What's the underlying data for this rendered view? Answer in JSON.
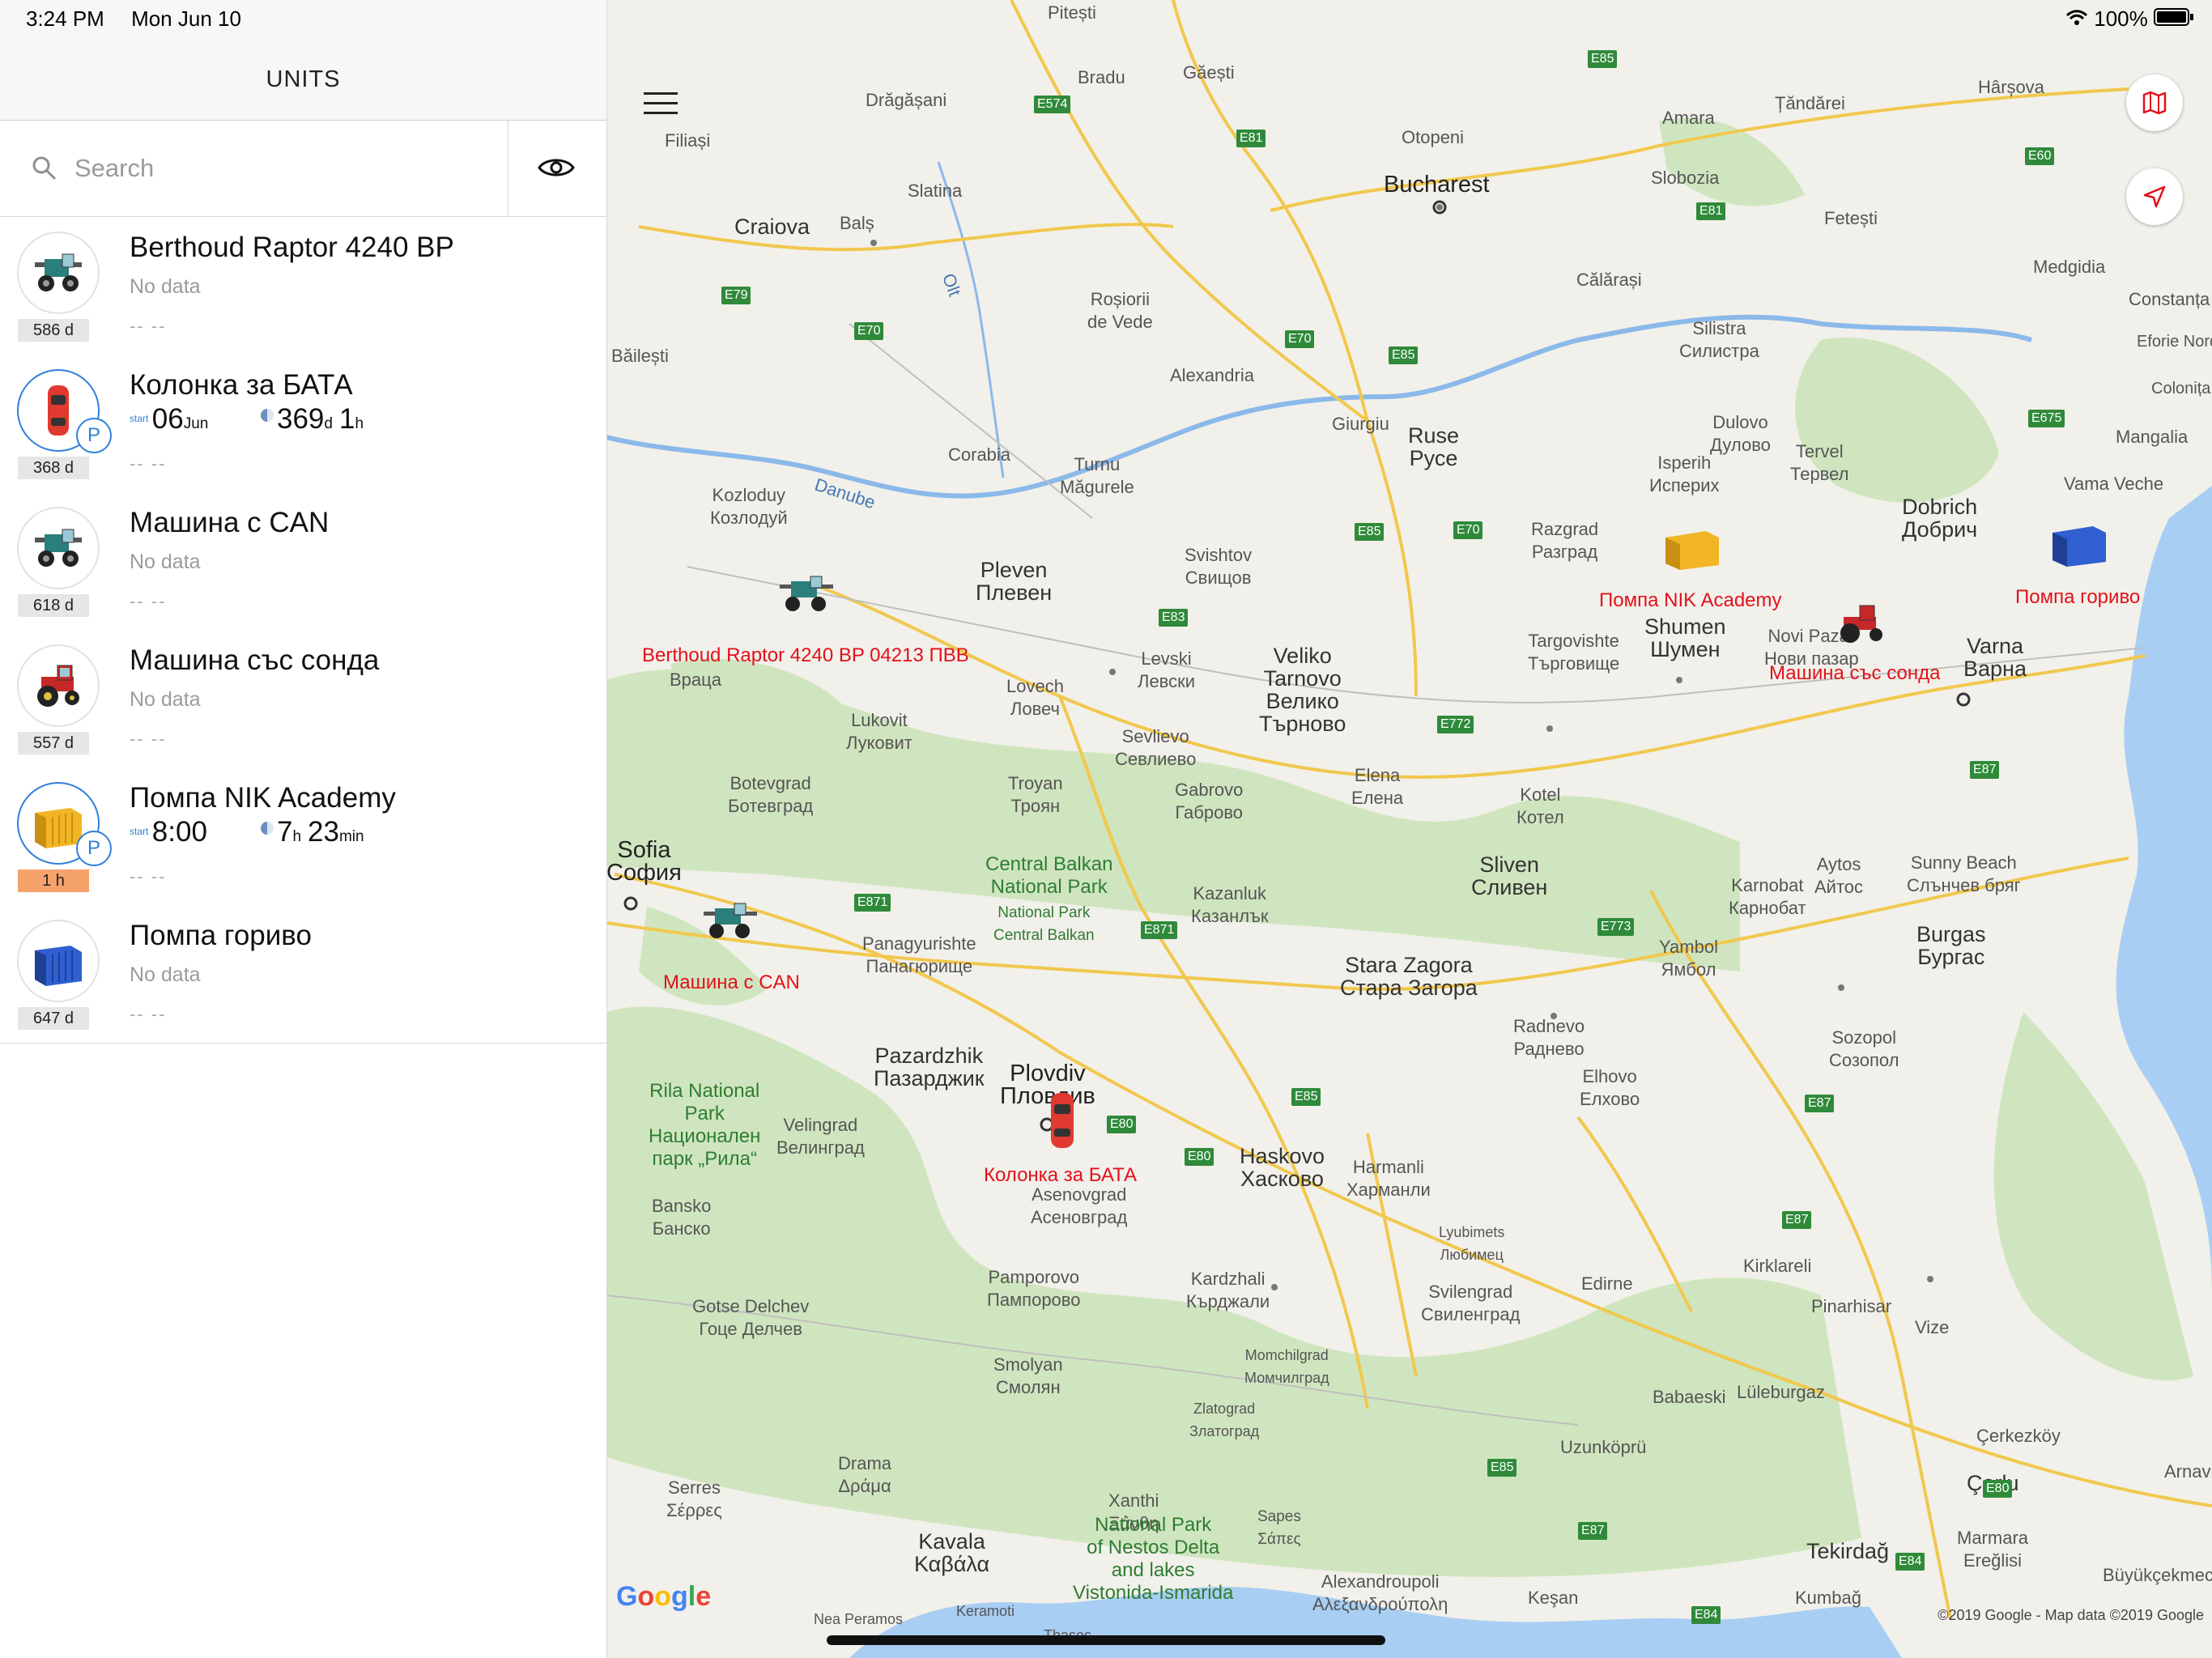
{
  "status_bar": {
    "time": "3:24 PM",
    "date": "Mon Jun 10",
    "battery": "100%"
  },
  "panel": {
    "title": "UNITS",
    "search": {
      "placeholder": "Search",
      "value": ""
    }
  },
  "units": [
    {
      "name": "Berthoud Raptor 4240 BP",
      "status": "No data",
      "dashes": "-- --",
      "age": "586 d",
      "icon": "sprayer-icon"
    },
    {
      "name": "Колонка за БАТА",
      "start_label": "start",
      "start_day": "06",
      "start_month": "Jun",
      "dur_days": "369",
      "dur_days_unit": "d",
      "dur_hours": "1",
      "dur_hours_unit": "h",
      "park": "P",
      "dashes": "-- --",
      "age": "368 d",
      "icon": "car-icon"
    },
    {
      "name": "Машина с CAN",
      "status": "No data",
      "dashes": "-- --",
      "age": "618 d",
      "icon": "sprayer-icon"
    },
    {
      "name": "Машина със сонда",
      "status": "No data",
      "dashes": "-- --",
      "age": "557 d",
      "icon": "tractor-icon"
    },
    {
      "name": "Помпа NIK Academy",
      "start_label": "start",
      "start_time": "8:00",
      "dur_hours": "7",
      "dur_hours_unit": "h",
      "dur_minutes": "23",
      "dur_minutes_unit": "min",
      "park": "P",
      "dashes": "-- --",
      "age": "1 h",
      "icon": "container-yellow-icon"
    },
    {
      "name": "Помпа гориво",
      "status": "No data",
      "dashes": "-- --",
      "age": "647 d",
      "icon": "container-blue-icon"
    }
  ],
  "map": {
    "markers": [
      {
        "label": "Berthoud Raptor 4240 BP 04213 ПВВ"
      },
      {
        "label": "Колонка за БАТА"
      },
      {
        "label": "Машина с CAN"
      },
      {
        "label": "Машина със сонда"
      },
      {
        "label": "Помпа NIK Academy"
      },
      {
        "label": "Помпа гориво"
      }
    ],
    "cities": [
      "Pitești",
      "Bradu",
      "Găești",
      "Drăgășani",
      "Filiași",
      "Slatina",
      "Craiova",
      "Balș",
      "Bucharest",
      "Otopeni",
      "Slobozia",
      "Amara",
      "Țăndărei",
      "Hârșova",
      "Fetești",
      "Călărași",
      "Medgidia",
      "Constanța",
      "Silistra\nСилистра",
      "Roșiorii\nde Vede",
      "Alexandria",
      "Băilești",
      "Giurgiu",
      "Ruse\nРусе",
      "Corabia",
      "Turnu\nMăgurele",
      "Kozloduy\nКозлодуй",
      "Danube",
      "Olt",
      "Pleven\nПлевен",
      "Svishtov\nСвищов",
      "Razgrad\nРазград",
      "Isperih\nИсперих",
      "Dulovo\nДулово",
      "Tervel\nТервел",
      "Dobrich\nДобрич",
      "Mangalia",
      "Vama Veche",
      "Veliko\nTarnovo\nВелико\nТърново",
      "Levski\nЛевски",
      "Lovech\nЛовеч",
      "Lukovit\nЛуковит",
      "Враца",
      "Sevlievo\nСевлиево",
      "Gabrovo\nГаброво",
      "Targovishte\nТърговище",
      "Shumen\nШумен",
      "Novi Pazar\nНови пазар",
      "Varna\nВарна",
      "Elena\nЕлена",
      "Kotel\nКотел",
      "Botevgrad\nБотевград",
      "Troyan\nТроян",
      "Sofia\nСофия",
      "Central Balkan\nNational Park",
      "National Park\nCentral Balkan",
      "Kazanluk\nКазанлък",
      "Sliven\nСливен",
      "Aytos\nАйтос",
      "Karnobat\nКарнобат",
      "Sunny Beach\nСлънчев бряг",
      "Burgas\nБургас",
      "Yambol\nЯмбол",
      "Stara Zagora\nСтара Загора",
      "Panagyurishte\nПанагюрище",
      "Radnevo\nРаднево",
      "Pazardzhik\nПазарджик",
      "Plovdiv\nПловдив",
      "Rila National\nPark\nНационален\nпарк „Рила“",
      "Velingrad\nВелинград",
      "Asenovgrad\nАсеновград",
      "Haskovo\nХасково",
      "Harmanli\nХарманли",
      "Elhovo\nЕлхово",
      "Sozopol\nСозопол",
      "Bansko\nБанско",
      "Lyubimets\nЛюбимец",
      "Kirklareli",
      "Pamporovo\nПампорово",
      "Kardzhali\nКърджали",
      "Svilengrad\nСвиленград",
      "Edirne",
      "Pinarhisar",
      "Vize",
      "Gotse Delchev\nГоце Делчев",
      "Momchilgrad\nМомчилград",
      "Smolyan\nСмолян",
      "Zlatograd\nЗлатоград",
      "Babaeski",
      "Lüleburgaz",
      "Çerkezköy",
      "Uzunköprü",
      "Çorlu",
      "Drama\nΔράμα",
      "Serres\nΣέρρες",
      "Xanthi\nΞάνθη",
      "Sapes\nΣάπες",
      "National Park\nof Nestos Delta\nand lakes\nVistonida-Ismarida",
      "Kavala\nΚαβάλα",
      "Alexandroupoli\nΑλεξανδρούπολη",
      "Keşan",
      "Tekirdağ",
      "Marmara\nEreğlisi",
      "Büyükçekmece",
      "Kumbağ",
      "Nea Peramos",
      "Keramoti",
      "Thasos",
      "Arnavu",
      "Eforie Nord",
      "Colonița"
    ],
    "roads": [
      "E574",
      "E85",
      "E81",
      "E60",
      "E81",
      "E79",
      "E70",
      "E70",
      "E85",
      "E675",
      "E85",
      "E70",
      "E83",
      "E772",
      "E87",
      "E871",
      "E871",
      "E773",
      "E85",
      "E80",
      "E80",
      "E87",
      "E87",
      "E85",
      "E87",
      "E84",
      "E80",
      "E84"
    ],
    "attribution": "©2019 Google - Map data ©2019 Google",
    "logo": "Google"
  },
  "colors": {
    "accent": "#2f80d9",
    "marker_label": "#e3101b",
    "water": "#a8cef3",
    "land": "#f2f0ea",
    "forest": "#cfe5bf",
    "warn_badge": "#f5a36b"
  }
}
